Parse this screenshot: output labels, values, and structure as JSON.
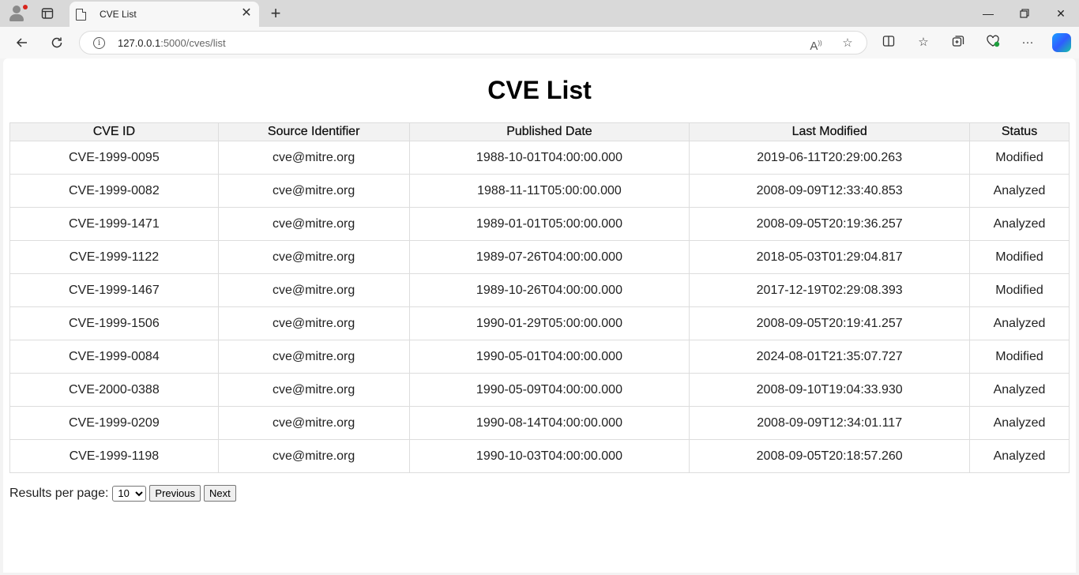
{
  "browser": {
    "tab_title": "CVE List",
    "url_host": "127.0.0.1",
    "url_rest": ":5000/cves/list"
  },
  "page": {
    "title": "CVE List"
  },
  "table": {
    "columns": [
      "CVE ID",
      "Source Identifier",
      "Published Date",
      "Last Modified",
      "Status"
    ],
    "rows": [
      [
        "CVE-1999-0095",
        "cve@mitre.org",
        "1988-10-01T04:00:00.000",
        "2019-06-11T20:29:00.263",
        "Modified"
      ],
      [
        "CVE-1999-0082",
        "cve@mitre.org",
        "1988-11-11T05:00:00.000",
        "2008-09-09T12:33:40.853",
        "Analyzed"
      ],
      [
        "CVE-1999-1471",
        "cve@mitre.org",
        "1989-01-01T05:00:00.000",
        "2008-09-05T20:19:36.257",
        "Analyzed"
      ],
      [
        "CVE-1999-1122",
        "cve@mitre.org",
        "1989-07-26T04:00:00.000",
        "2018-05-03T01:29:04.817",
        "Modified"
      ],
      [
        "CVE-1999-1467",
        "cve@mitre.org",
        "1989-10-26T04:00:00.000",
        "2017-12-19T02:29:08.393",
        "Modified"
      ],
      [
        "CVE-1999-1506",
        "cve@mitre.org",
        "1990-01-29T05:00:00.000",
        "2008-09-05T20:19:41.257",
        "Analyzed"
      ],
      [
        "CVE-1999-0084",
        "cve@mitre.org",
        "1990-05-01T04:00:00.000",
        "2024-08-01T21:35:07.727",
        "Modified"
      ],
      [
        "CVE-2000-0388",
        "cve@mitre.org",
        "1990-05-09T04:00:00.000",
        "2008-09-10T19:04:33.930",
        "Analyzed"
      ],
      [
        "CVE-1999-0209",
        "cve@mitre.org",
        "1990-08-14T04:00:00.000",
        "2008-09-09T12:34:01.117",
        "Analyzed"
      ],
      [
        "CVE-1999-1198",
        "cve@mitre.org",
        "1990-10-03T04:00:00.000",
        "2008-09-05T20:18:57.260",
        "Analyzed"
      ]
    ]
  },
  "pager": {
    "label": "Results per page:",
    "selected": "10",
    "prev_label": "Previous",
    "next_label": "Next"
  }
}
